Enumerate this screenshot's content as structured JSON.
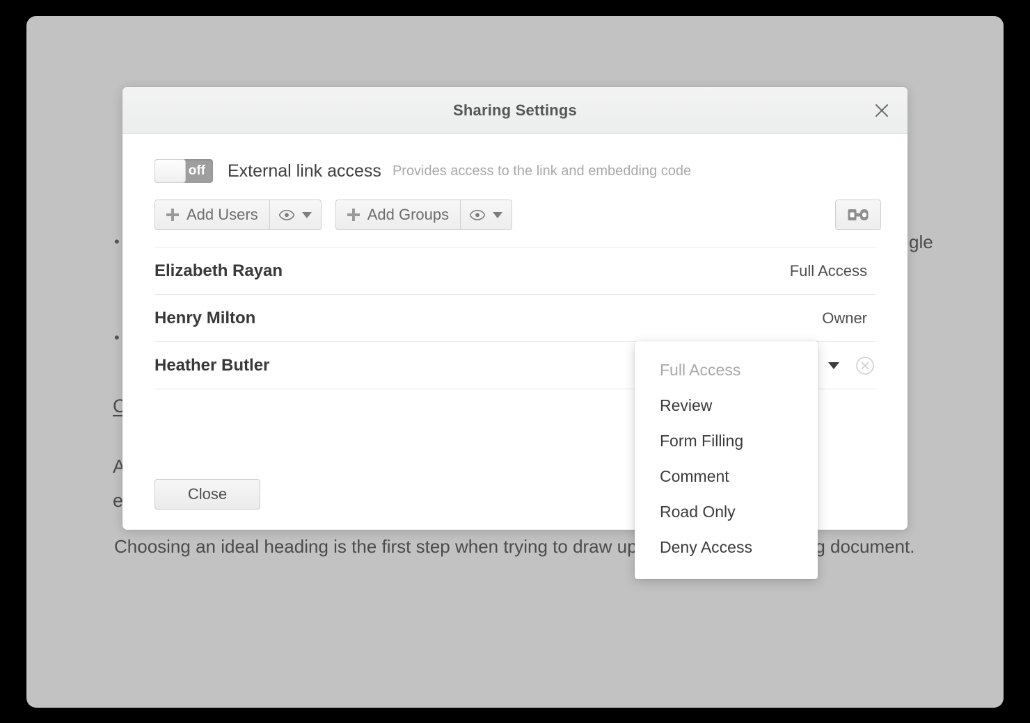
{
  "background_document": {
    "fragments": [
      {
        "text": "•",
        "kind": "bullet"
      },
      {
        "text": "gle",
        "kind": "text"
      },
      {
        "text": "•",
        "kind": "bullet"
      },
      {
        "text": "C",
        "kind": "link"
      },
      {
        "text": "A",
        "kind": "text"
      },
      {
        "text": "e",
        "kind": "text"
      }
    ],
    "paragraph": "Choosing an ideal heading is the first step when trying to draw up a well pleasant-looking document."
  },
  "modal": {
    "title": "Sharing Settings",
    "close_icon": "close-icon",
    "external_link": {
      "state_label": "off",
      "enabled": false,
      "label": "External link access",
      "hint": "Provides access to the link and embedding code"
    },
    "toolbar": {
      "add_users_label": "Add Users",
      "add_groups_label": "Add Groups",
      "plus_icon": "plus-icon",
      "eye_icon": "eye-icon",
      "caret_icon": "chevron-down-icon",
      "link_icon": "link-icon"
    },
    "users": [
      {
        "name": "Elizabeth Rayan",
        "access": "Full Access",
        "editable": false,
        "removable": false
      },
      {
        "name": "Henry Milton",
        "access": "Owner",
        "editable": false,
        "removable": false
      },
      {
        "name": "Heather Butler",
        "access": "Full Access",
        "editable": true,
        "removable": true
      }
    ],
    "role_menu": {
      "selected": "Full Access",
      "options": [
        "Full Access",
        "Review",
        "Form Filling",
        "Comment",
        "Road Only",
        "Deny Access"
      ]
    },
    "footer": {
      "close_label": "Close"
    }
  },
  "colors": {
    "backdrop": "#c2c2c2",
    "modal_bg": "#ffffff",
    "header_bg": "#f0f0f0",
    "text_primary": "#383838",
    "text_muted": "#a9a9a9",
    "switch_off": "#9e9e9e"
  }
}
